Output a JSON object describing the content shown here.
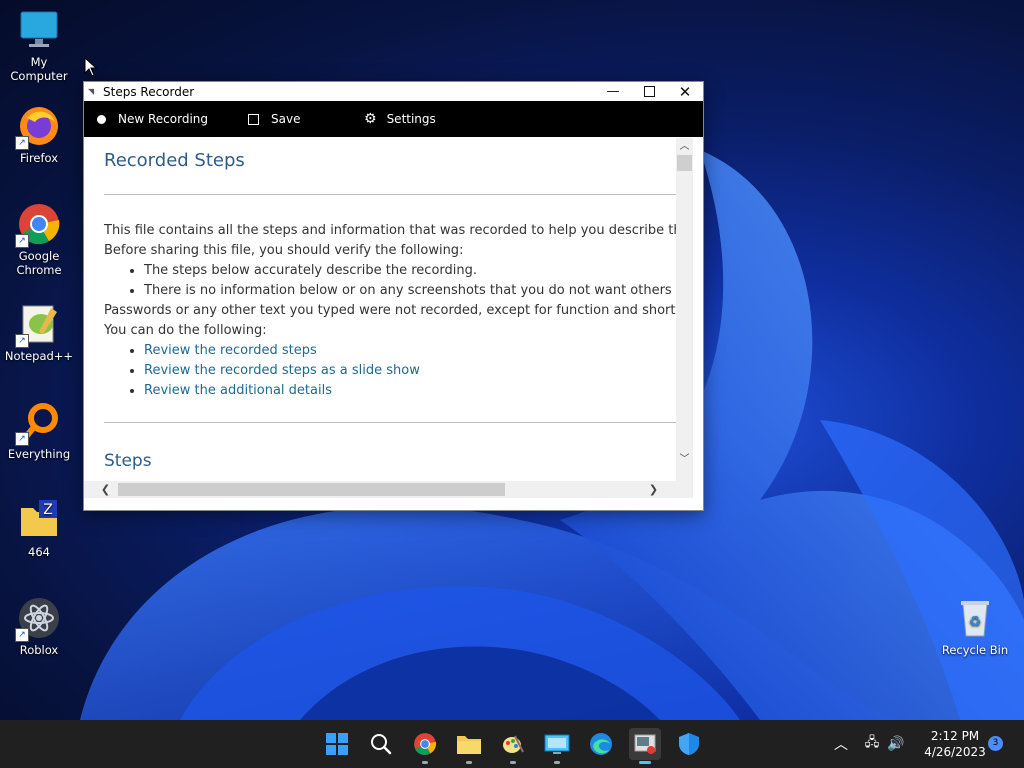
{
  "desktop": {
    "icons": [
      {
        "label": "My Computer"
      },
      {
        "label": "Firefox"
      },
      {
        "label": "Google Chrome"
      },
      {
        "label": "Notepad++"
      },
      {
        "label": "Everything"
      },
      {
        "label": "464"
      },
      {
        "label": "Roblox"
      },
      {
        "label": "Recycle Bin"
      }
    ]
  },
  "window": {
    "title": "Steps Recorder",
    "toolbar": {
      "new_recording": "New Recording",
      "save": "Save",
      "settings": "Settings"
    },
    "content": {
      "heading": "Recorded Steps",
      "intro": "This file contains all the steps and information that was recorded to help you describe the recc",
      "verify": "Before sharing this file, you should verify the following:",
      "bullets": [
        "The steps below accurately describe the recording.",
        "There is no information below or on any screenshots that you do not want others to se"
      ],
      "passwords": "Passwords or any other text you typed were not recorded, except for function and shortcut ke",
      "can_do": "You can do the following:",
      "links": [
        "Review the recorded steps",
        "Review the recorded steps as a slide show",
        "Review the additional details"
      ],
      "steps_heading": "Steps"
    }
  },
  "taskbar": {
    "time": "2:12 PM",
    "date": "4/26/2023",
    "notification_count": "3"
  },
  "colors": {
    "taskbar_bg": "#202020",
    "toolbar_bg": "#000000",
    "heading": "#2f5b8a",
    "link": "#1b6a8f"
  }
}
